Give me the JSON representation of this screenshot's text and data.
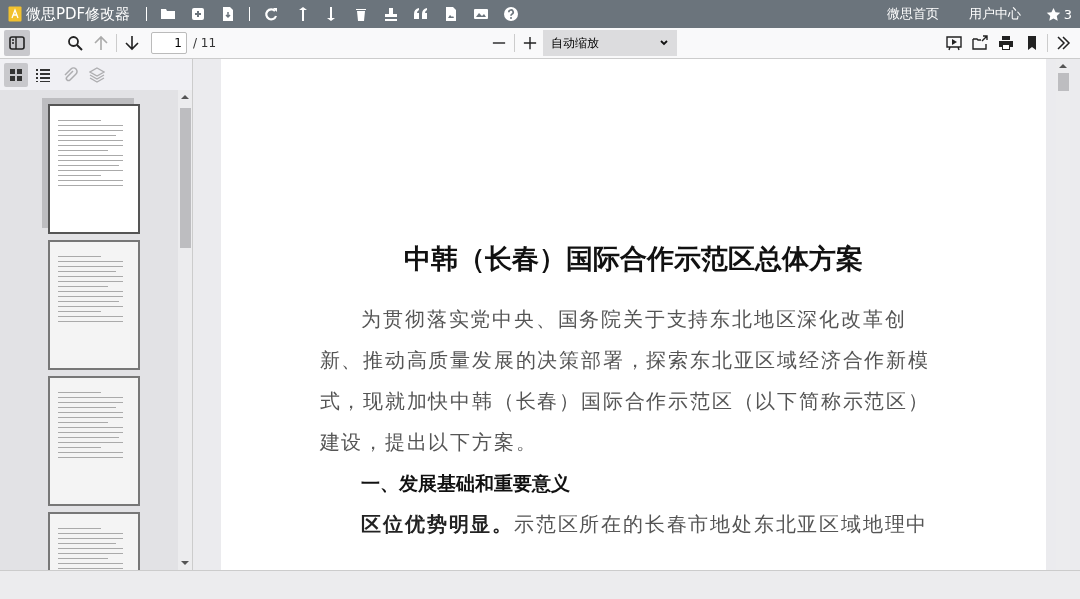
{
  "app": {
    "title": "微思PDF修改器",
    "links": [
      "微思首页",
      "用户中心"
    ],
    "stars": "3"
  },
  "toolbar": {
    "sidebar_toggle": {
      "selected": true
    },
    "page": {
      "value": "1",
      "total": "/ 11"
    },
    "zoom": {
      "value": "自动缩放"
    }
  },
  "sidebar": {
    "tabs": [
      {
        "kind": "thumbnails",
        "selected": true,
        "disabled": false
      },
      {
        "kind": "outline",
        "selected": false,
        "disabled": false
      },
      {
        "kind": "attachments",
        "selected": false,
        "disabled": true
      },
      {
        "kind": "layers",
        "selected": false,
        "disabled": true
      }
    ],
    "thumbnails": [
      {
        "selected": true
      },
      {
        "selected": false
      },
      {
        "selected": false
      },
      {
        "selected": false
      }
    ]
  },
  "document": {
    "title": "中韩（长春）国际合作示范区总体方案",
    "blocks": [
      {
        "kind": "paragraph",
        "text": "为贯彻落实党中央、国务院关于支持东北地区深化改革创新、推动高质量发展的决策部署，探索东北亚区域经济合作新模式，现就加快中韩（长春）国际合作示范区（以下简称示范区）建设，提出以下方案。"
      },
      {
        "kind": "heading",
        "text": "一、发展基础和重要意义"
      },
      {
        "kind": "paragraph",
        "text": "**区位优势明显。**示范区所在的长春市地处东北亚区域地理中"
      }
    ]
  }
}
